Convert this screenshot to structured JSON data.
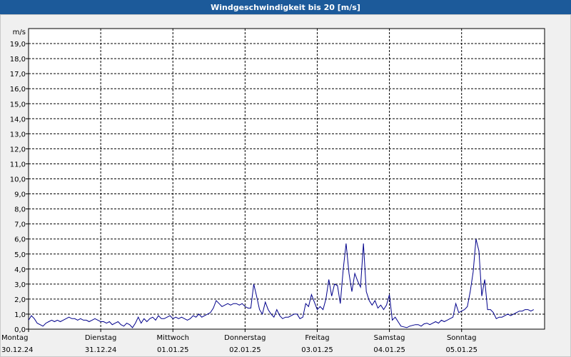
{
  "window": {
    "title": "Windgeschwindigkeit bis 20 [m/s]"
  },
  "chart_data": {
    "type": "line",
    "title": "Windgeschwindigkeit bis 20 [m/s]",
    "ylabel": "m/s",
    "ylim": [
      0,
      20
    ],
    "yticks": [
      "0,0",
      "1,0",
      "2,0",
      "3,0",
      "4,0",
      "5,0",
      "6,0",
      "7,0",
      "8,0",
      "9,0",
      "10,0",
      "11,0",
      "12,0",
      "13,0",
      "14,0",
      "15,0",
      "16,0",
      "17,0",
      "18,0",
      "19,0"
    ],
    "grid": true,
    "xlim_days": [
      0,
      7.15
    ],
    "days": [
      {
        "weekday": "Montag",
        "date": "30.12.24"
      },
      {
        "weekday": "Dienstag",
        "date": "31.12.24"
      },
      {
        "weekday": "Mittwoch",
        "date": "01.01.25"
      },
      {
        "weekday": "Donnerstag",
        "date": "02.01.25"
      },
      {
        "weekday": "Freitag",
        "date": "03.01.25"
      },
      {
        "weekday": "Samstag",
        "date": "04.01.25"
      },
      {
        "weekday": "Sonntag",
        "date": "05.01.25"
      }
    ],
    "series": [
      {
        "color": "#00008b",
        "points": [
          [
            0.0,
            0.6
          ],
          [
            0.04,
            0.9
          ],
          [
            0.08,
            0.7
          ],
          [
            0.12,
            0.4
          ],
          [
            0.16,
            0.3
          ],
          [
            0.2,
            0.2
          ],
          [
            0.24,
            0.4
          ],
          [
            0.28,
            0.5
          ],
          [
            0.32,
            0.6
          ],
          [
            0.36,
            0.5
          ],
          [
            0.4,
            0.6
          ],
          [
            0.44,
            0.5
          ],
          [
            0.48,
            0.6
          ],
          [
            0.52,
            0.7
          ],
          [
            0.56,
            0.8
          ],
          [
            0.6,
            0.7
          ],
          [
            0.64,
            0.7
          ],
          [
            0.68,
            0.6
          ],
          [
            0.72,
            0.7
          ],
          [
            0.76,
            0.6
          ],
          [
            0.8,
            0.6
          ],
          [
            0.84,
            0.5
          ],
          [
            0.88,
            0.6
          ],
          [
            0.92,
            0.7
          ],
          [
            0.96,
            0.6
          ],
          [
            1.0,
            0.5
          ],
          [
            1.04,
            0.5
          ],
          [
            1.08,
            0.4
          ],
          [
            1.12,
            0.5
          ],
          [
            1.16,
            0.3
          ],
          [
            1.2,
            0.4
          ],
          [
            1.24,
            0.5
          ],
          [
            1.28,
            0.3
          ],
          [
            1.32,
            0.2
          ],
          [
            1.36,
            0.4
          ],
          [
            1.4,
            0.3
          ],
          [
            1.44,
            0.1
          ],
          [
            1.48,
            0.4
          ],
          [
            1.52,
            0.8
          ],
          [
            1.56,
            0.4
          ],
          [
            1.6,
            0.7
          ],
          [
            1.64,
            0.5
          ],
          [
            1.68,
            0.7
          ],
          [
            1.72,
            0.8
          ],
          [
            1.76,
            0.6
          ],
          [
            1.8,
            0.9
          ],
          [
            1.84,
            0.7
          ],
          [
            1.88,
            0.7
          ],
          [
            1.92,
            0.8
          ],
          [
            1.96,
            0.9
          ],
          [
            2.0,
            0.7
          ],
          [
            2.04,
            0.8
          ],
          [
            2.08,
            0.7
          ],
          [
            2.12,
            0.8
          ],
          [
            2.16,
            0.7
          ],
          [
            2.2,
            0.6
          ],
          [
            2.24,
            0.7
          ],
          [
            2.28,
            0.9
          ],
          [
            2.32,
            0.8
          ],
          [
            2.36,
            1.0
          ],
          [
            2.4,
            0.8
          ],
          [
            2.44,
            0.9
          ],
          [
            2.48,
            1.0
          ],
          [
            2.52,
            1.1
          ],
          [
            2.56,
            1.4
          ],
          [
            2.6,
            1.9
          ],
          [
            2.64,
            1.7
          ],
          [
            2.68,
            1.5
          ],
          [
            2.72,
            1.6
          ],
          [
            2.76,
            1.7
          ],
          [
            2.8,
            1.6
          ],
          [
            2.84,
            1.7
          ],
          [
            2.88,
            1.7
          ],
          [
            2.92,
            1.6
          ],
          [
            2.96,
            1.7
          ],
          [
            3.0,
            1.5
          ],
          [
            3.04,
            1.4
          ],
          [
            3.08,
            1.4
          ],
          [
            3.12,
            3.0
          ],
          [
            3.16,
            2.2
          ],
          [
            3.2,
            1.3
          ],
          [
            3.24,
            1.0
          ],
          [
            3.28,
            1.8
          ],
          [
            3.32,
            1.3
          ],
          [
            3.36,
            1.0
          ],
          [
            3.4,
            0.8
          ],
          [
            3.44,
            1.3
          ],
          [
            3.48,
            0.9
          ],
          [
            3.52,
            0.7
          ],
          [
            3.56,
            0.8
          ],
          [
            3.6,
            0.8
          ],
          [
            3.64,
            0.9
          ],
          [
            3.68,
            1.0
          ],
          [
            3.72,
            1.0
          ],
          [
            3.76,
            0.7
          ],
          [
            3.8,
            0.8
          ],
          [
            3.84,
            1.7
          ],
          [
            3.88,
            1.5
          ],
          [
            3.92,
            2.3
          ],
          [
            3.96,
            1.8
          ],
          [
            4.0,
            1.3
          ],
          [
            4.04,
            1.5
          ],
          [
            4.08,
            1.3
          ],
          [
            4.12,
            2.0
          ],
          [
            4.16,
            3.3
          ],
          [
            4.2,
            2.2
          ],
          [
            4.24,
            3.0
          ],
          [
            4.28,
            2.9
          ],
          [
            4.32,
            1.7
          ],
          [
            4.36,
            4.0
          ],
          [
            4.4,
            5.7
          ],
          [
            4.44,
            3.7
          ],
          [
            4.48,
            2.5
          ],
          [
            4.52,
            3.7
          ],
          [
            4.56,
            3.2
          ],
          [
            4.6,
            2.8
          ],
          [
            4.64,
            5.7
          ],
          [
            4.68,
            2.5
          ],
          [
            4.72,
            1.9
          ],
          [
            4.76,
            1.6
          ],
          [
            4.8,
            1.9
          ],
          [
            4.84,
            1.4
          ],
          [
            4.88,
            1.6
          ],
          [
            4.92,
            1.3
          ],
          [
            4.96,
            1.6
          ],
          [
            5.0,
            2.3
          ],
          [
            5.04,
            0.6
          ],
          [
            5.08,
            0.8
          ],
          [
            5.12,
            0.5
          ],
          [
            5.16,
            0.2
          ],
          [
            5.2,
            0.15
          ],
          [
            5.24,
            0.1
          ],
          [
            5.28,
            0.2
          ],
          [
            5.32,
            0.25
          ],
          [
            5.36,
            0.3
          ],
          [
            5.4,
            0.3
          ],
          [
            5.44,
            0.2
          ],
          [
            5.48,
            0.35
          ],
          [
            5.52,
            0.4
          ],
          [
            5.56,
            0.3
          ],
          [
            5.6,
            0.4
          ],
          [
            5.64,
            0.5
          ],
          [
            5.68,
            0.4
          ],
          [
            5.72,
            0.6
          ],
          [
            5.76,
            0.5
          ],
          [
            5.8,
            0.6
          ],
          [
            5.84,
            0.7
          ],
          [
            5.88,
            0.8
          ],
          [
            5.92,
            1.7
          ],
          [
            5.96,
            1.1
          ],
          [
            6.0,
            1.2
          ],
          [
            6.04,
            1.3
          ],
          [
            6.08,
            1.5
          ],
          [
            6.12,
            2.5
          ],
          [
            6.16,
            3.8
          ],
          [
            6.2,
            6.0
          ],
          [
            6.24,
            5.2
          ],
          [
            6.28,
            2.2
          ],
          [
            6.32,
            3.3
          ],
          [
            6.36,
            1.3
          ],
          [
            6.4,
            1.3
          ],
          [
            6.44,
            1.1
          ],
          [
            6.48,
            0.7
          ],
          [
            6.52,
            0.8
          ],
          [
            6.56,
            0.8
          ],
          [
            6.6,
            0.9
          ],
          [
            6.64,
            1.0
          ],
          [
            6.68,
            0.9
          ],
          [
            6.72,
            1.0
          ],
          [
            6.76,
            1.1
          ],
          [
            6.8,
            1.2
          ],
          [
            6.84,
            1.2
          ],
          [
            6.88,
            1.3
          ],
          [
            6.92,
            1.3
          ],
          [
            6.96,
            1.2
          ],
          [
            7.0,
            1.3
          ]
        ]
      }
    ]
  }
}
